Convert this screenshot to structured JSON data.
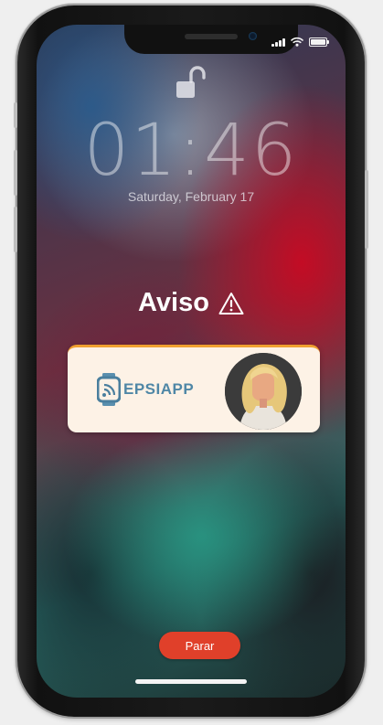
{
  "lockscreen": {
    "time": "01:46",
    "date": "Saturday, February 17"
  },
  "alert": {
    "title": "Aviso",
    "icon": "warning-triangle-icon",
    "logo_text": "EPSIAPP",
    "accent_color": "#f0a030"
  },
  "actions": {
    "stop_label": "Parar",
    "stop_color": "#e0402a"
  },
  "status_bar": {
    "icons": [
      "signal-icon",
      "wifi-icon",
      "battery-icon"
    ]
  }
}
